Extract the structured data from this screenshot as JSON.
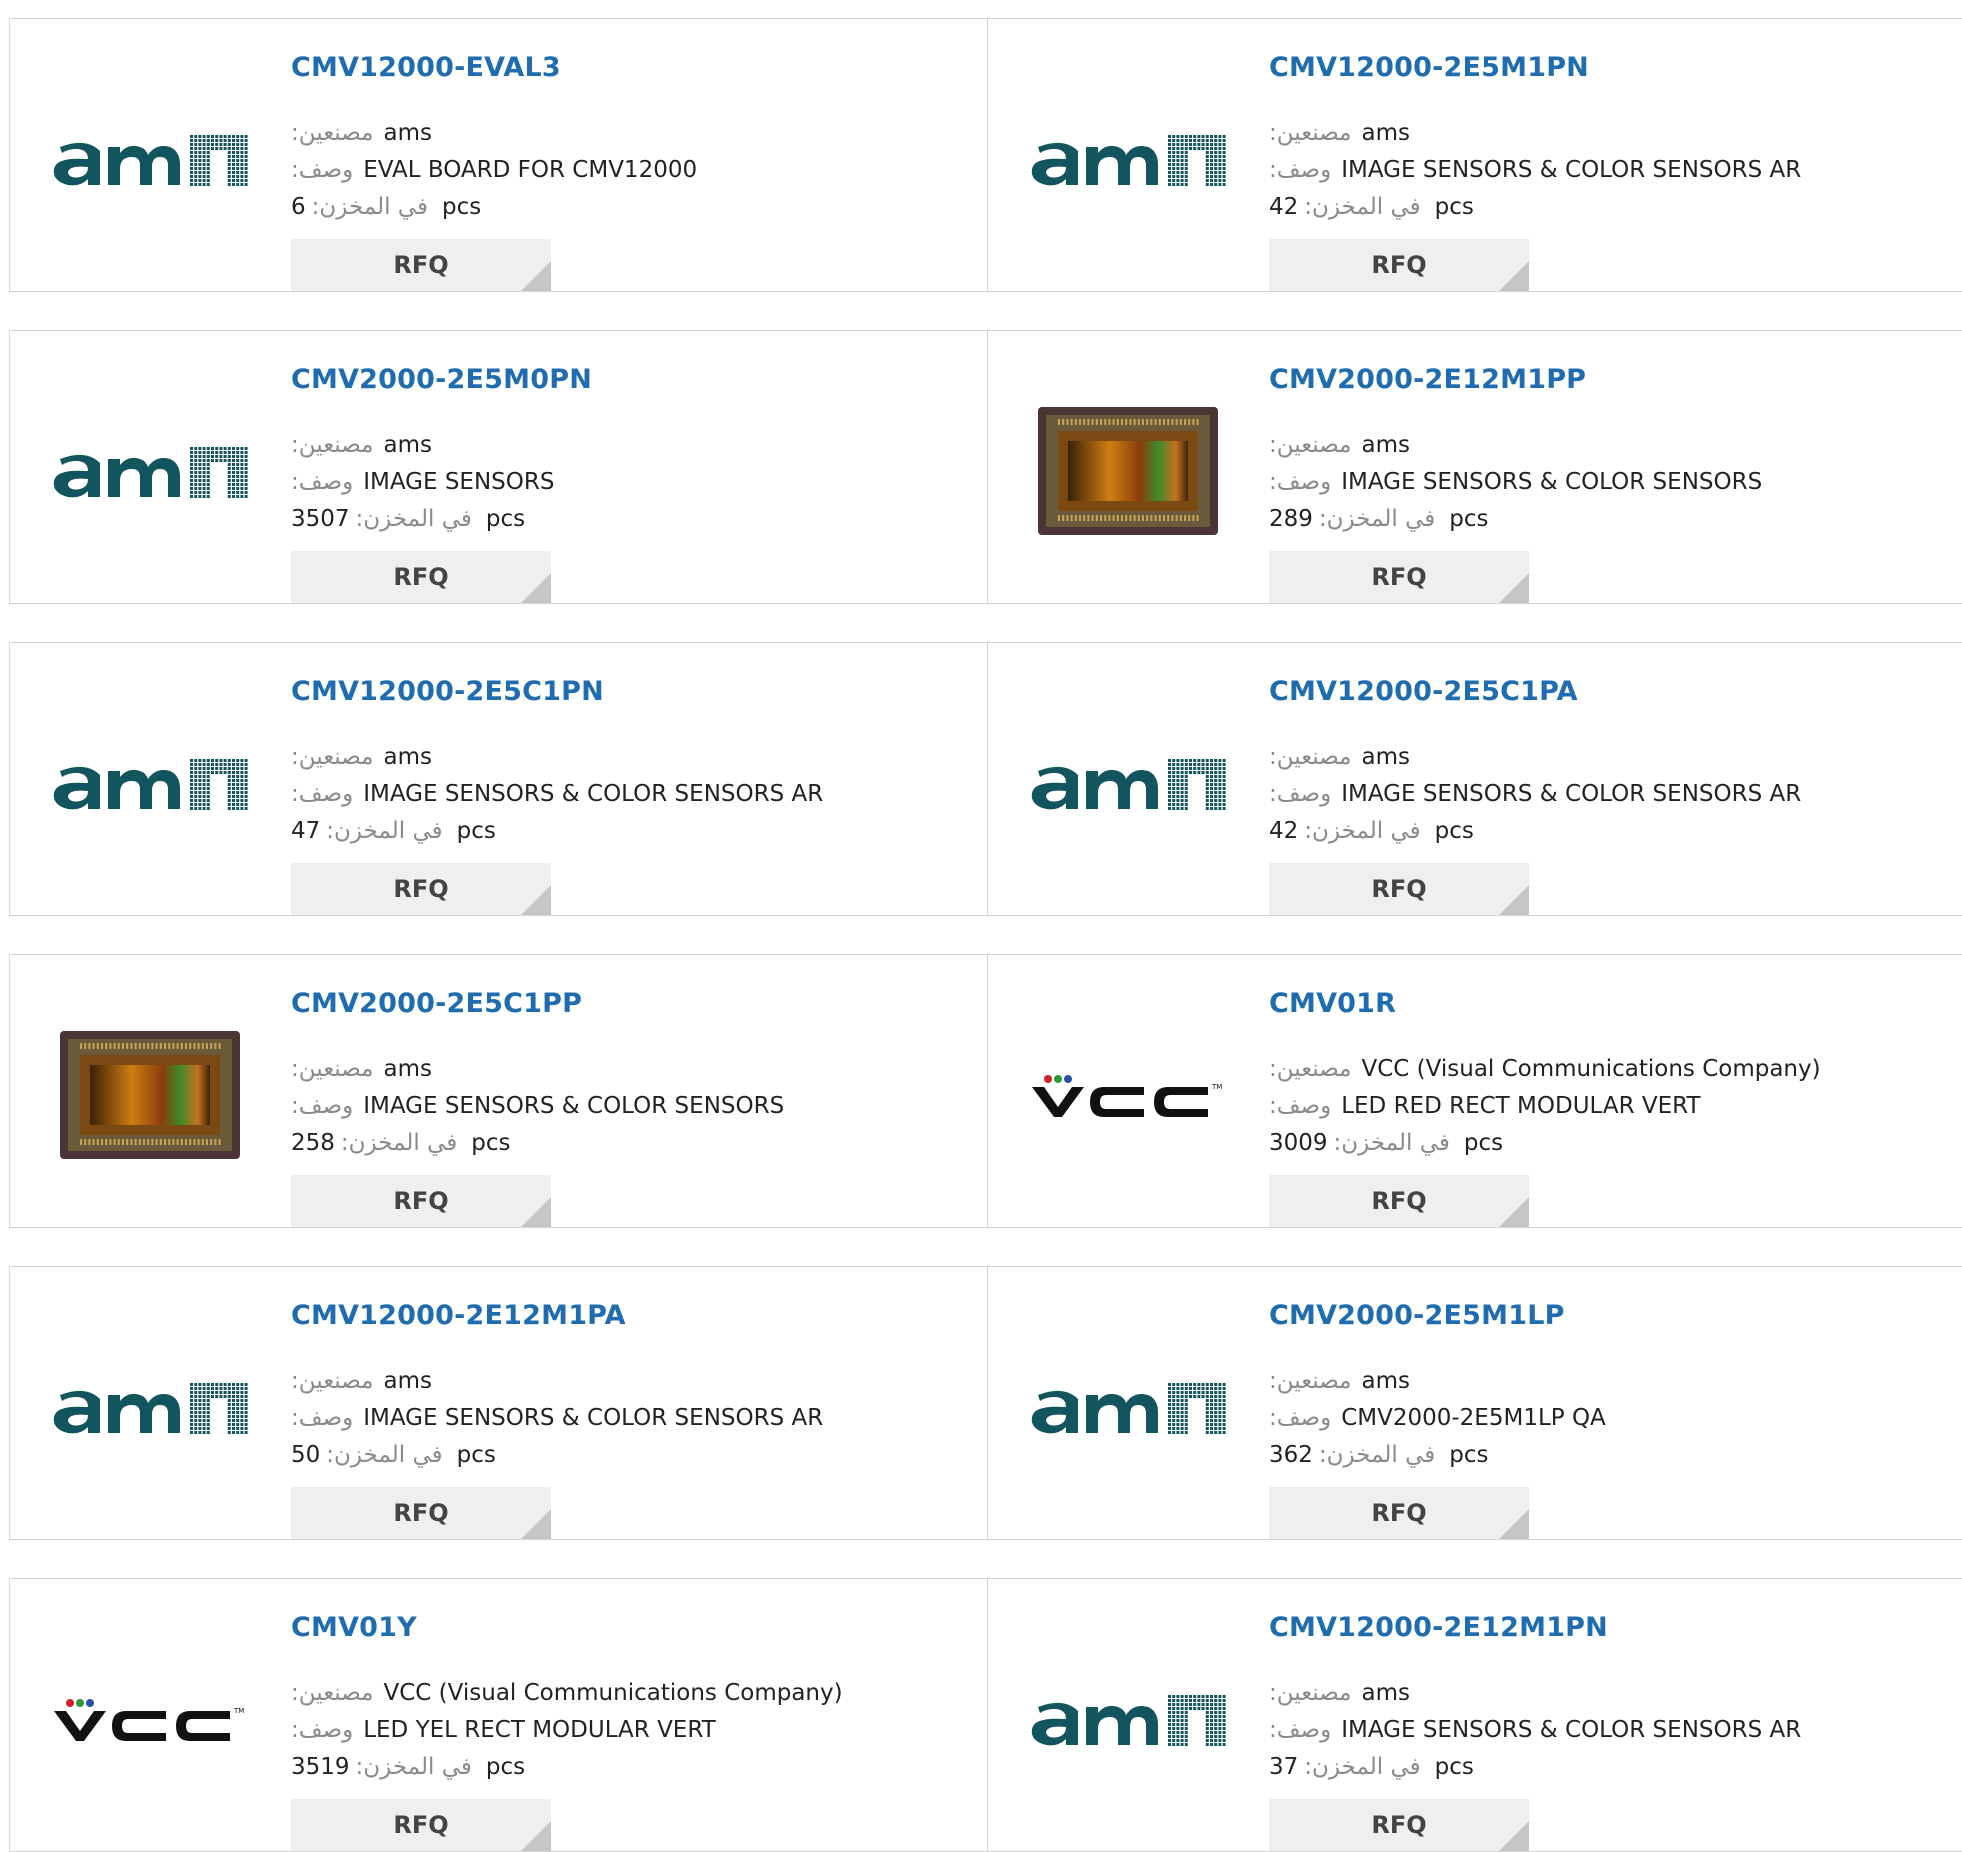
{
  "labels": {
    "manufacturer": "مصنعين:",
    "description": "وصف:",
    "in_stock": "في المخزن:",
    "pcs": "pcs",
    "rfq": "RFQ"
  },
  "colors": {
    "part_link": "#1f6cb0",
    "ams_logo": "#13555f",
    "rfq_bg": "#efefef",
    "rfq_corner": "#c6c6c6"
  },
  "products": [
    {
      "part": "CMV12000-EVAL3",
      "manufacturer": "ams",
      "description": "EVAL BOARD FOR CMV12000",
      "stock": "6",
      "image": "ams-logo"
    },
    {
      "part": "CMV12000-2E5M1PN",
      "manufacturer": "ams",
      "description": "IMAGE SENSORS & COLOR SENSORS AR",
      "stock": "42",
      "image": "ams-logo"
    },
    {
      "part": "CMV2000-2E5M0PN",
      "manufacturer": "ams",
      "description": "IMAGE SENSORS",
      "stock": "3507",
      "image": "ams-logo"
    },
    {
      "part": "CMV2000-2E12M1PP",
      "manufacturer": "ams",
      "description": "IMAGE SENSORS & COLOR SENSORS",
      "stock": "289",
      "image": "sensor-chip"
    },
    {
      "part": "CMV12000-2E5C1PN",
      "manufacturer": "ams",
      "description": "IMAGE SENSORS & COLOR SENSORS AR",
      "stock": "47",
      "image": "ams-logo"
    },
    {
      "part": "CMV12000-2E5C1PA",
      "manufacturer": "ams",
      "description": "IMAGE SENSORS & COLOR SENSORS AR",
      "stock": "42",
      "image": "ams-logo"
    },
    {
      "part": "CMV2000-2E5C1PP",
      "manufacturer": "ams",
      "description": "IMAGE SENSORS & COLOR SENSORS",
      "stock": "258",
      "image": "sensor-chip"
    },
    {
      "part": "CMV01R",
      "manufacturer": "VCC (Visual Communications Company)",
      "description": "LED RED RECT MODULAR VERT",
      "stock": "3009",
      "image": "vcc-logo"
    },
    {
      "part": "CMV12000-2E12M1PA",
      "manufacturer": "ams",
      "description": "IMAGE SENSORS & COLOR SENSORS AR",
      "stock": "50",
      "image": "ams-logo"
    },
    {
      "part": "CMV2000-2E5M1LP",
      "manufacturer": "ams",
      "description": "CMV2000-2E5M1LP QA",
      "stock": "362",
      "image": "ams-logo"
    },
    {
      "part": "CMV01Y",
      "manufacturer": "VCC (Visual Communications Company)",
      "description": "LED YEL RECT MODULAR VERT",
      "stock": "3519",
      "image": "vcc-logo"
    },
    {
      "part": "CMV12000-2E12M1PN",
      "manufacturer": "ams",
      "description": "IMAGE SENSORS & COLOR SENSORS AR",
      "stock": "37",
      "image": "ams-logo"
    }
  ]
}
